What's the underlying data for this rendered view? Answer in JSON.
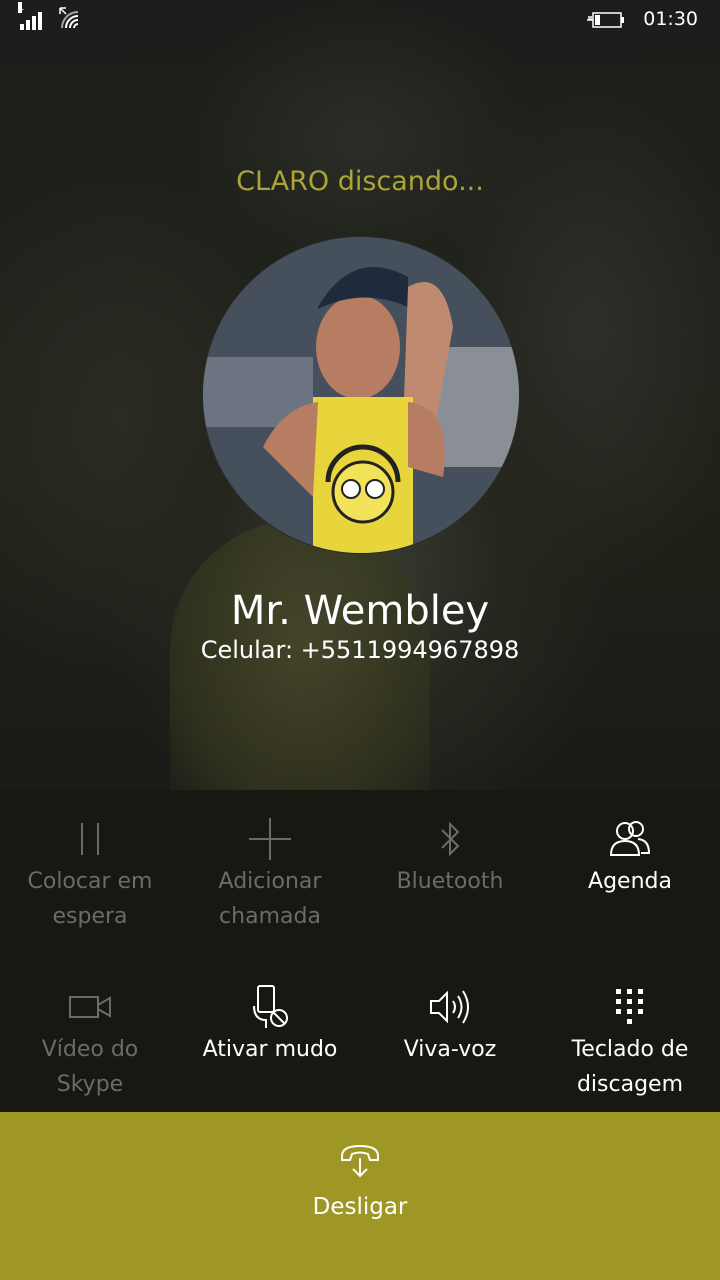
{
  "status_bar": {
    "sim_number": "1",
    "time": "01:30"
  },
  "call": {
    "status": "CLARO discando...",
    "contact_name": "Mr. Wembley",
    "contact_number": "Celular: +5511994967898"
  },
  "actions": [
    {
      "label_line1": "Colocar em",
      "label_line2": "espera",
      "icon": "pause-icon",
      "enabled": false
    },
    {
      "label_line1": "Adicionar",
      "label_line2": "chamada",
      "icon": "add-call-icon",
      "enabled": false
    },
    {
      "label_line1": "Bluetooth",
      "label_line2": "",
      "icon": "bluetooth-icon",
      "enabled": false
    },
    {
      "label_line1": "Agenda",
      "label_line2": "",
      "icon": "contacts-icon",
      "enabled": true
    },
    {
      "label_line1": "Vídeo do",
      "label_line2": "Skype",
      "icon": "video-icon",
      "enabled": false
    },
    {
      "label_line1": "Ativar mudo",
      "label_line2": "",
      "icon": "mute-icon",
      "enabled": true
    },
    {
      "label_line1": "Viva-voz",
      "label_line2": "",
      "icon": "speaker-icon",
      "enabled": true
    },
    {
      "label_line1": "Teclado de",
      "label_line2": "discagem",
      "icon": "keypad-icon",
      "enabled": true
    }
  ],
  "end_call": {
    "label": "Desligar",
    "icon": "hang-up-icon"
  },
  "colors": {
    "accent": "#aca536",
    "end_bar": "#9e9625",
    "panel": "#171812"
  }
}
